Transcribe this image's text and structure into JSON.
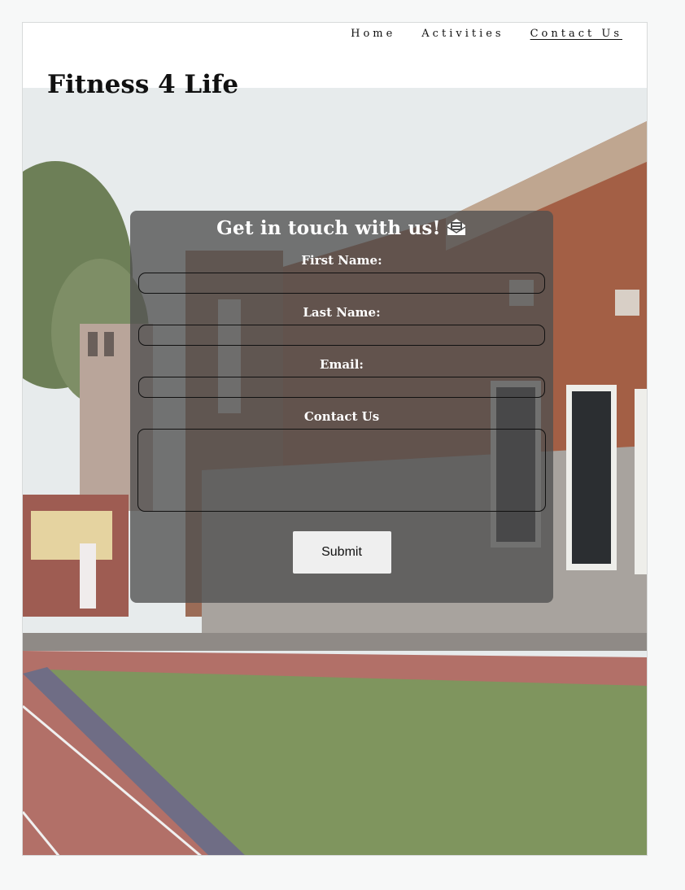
{
  "nav": {
    "items": [
      "Home",
      "Activities",
      "Contact Us"
    ],
    "active": "Contact Us"
  },
  "site": {
    "title": "Fitness 4 Life"
  },
  "form": {
    "heading": "Get in touch with us!",
    "heading_icon": "envelope-open-icon",
    "first_name_label": "First Name:",
    "last_name_label": "Last Name:",
    "email_label": "Email:",
    "message_label": "Contact Us",
    "first_name_value": "",
    "last_name_value": "",
    "email_value": "",
    "message_value": "",
    "submit_label": "Submit"
  },
  "colors": {
    "panel": "#505050",
    "page_bg": "#ffffff",
    "button_bg": "#efefef"
  }
}
